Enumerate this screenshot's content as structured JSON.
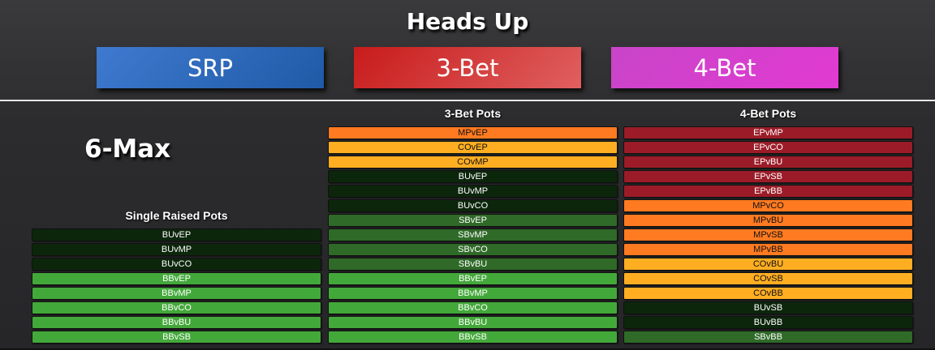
{
  "header": {
    "title": "Heads Up"
  },
  "buttons": [
    {
      "label": "SRP",
      "color": "#2a64b4"
    },
    {
      "label": "3-Bet",
      "color": "#d33a3a"
    },
    {
      "label": "4-Bet",
      "color": "#d63ed0"
    }
  ],
  "format_label": "6-Max",
  "columns": [
    {
      "title": "Single Raised Pots",
      "items": [
        {
          "label": "BUvEP",
          "color": "dark"
        },
        {
          "label": "BUvMP",
          "color": "dark"
        },
        {
          "label": "BUvCO",
          "color": "dark"
        },
        {
          "label": "BBvEP",
          "color": "light"
        },
        {
          "label": "BBvMP",
          "color": "light"
        },
        {
          "label": "BBvCO",
          "color": "light"
        },
        {
          "label": "BBvBU",
          "color": "light"
        },
        {
          "label": "BBvSB",
          "color": "light"
        }
      ]
    },
    {
      "title": "3-Bet Pots",
      "items": [
        {
          "label": "MPvEP",
          "color": "orange"
        },
        {
          "label": "COvEP",
          "color": "yellow"
        },
        {
          "label": "COvMP",
          "color": "yellow"
        },
        {
          "label": "BUvEP",
          "color": "dark"
        },
        {
          "label": "BUvMP",
          "color": "dark"
        },
        {
          "label": "BUvCO",
          "color": "dark"
        },
        {
          "label": "SBvEP",
          "color": "med"
        },
        {
          "label": "SBvMP",
          "color": "med"
        },
        {
          "label": "SBvCO",
          "color": "med"
        },
        {
          "label": "SBvBU",
          "color": "med"
        },
        {
          "label": "BBvEP",
          "color": "light"
        },
        {
          "label": "BBvMP",
          "color": "light"
        },
        {
          "label": "BBvCO",
          "color": "light"
        },
        {
          "label": "BBvBU",
          "color": "light"
        },
        {
          "label": "BBvSB",
          "color": "light"
        }
      ]
    },
    {
      "title": "4-Bet Pots",
      "items": [
        {
          "label": "EPvMP",
          "color": "red"
        },
        {
          "label": "EPvCO",
          "color": "red"
        },
        {
          "label": "EPvBU",
          "color": "red"
        },
        {
          "label": "EPvSB",
          "color": "red"
        },
        {
          "label": "EPvBB",
          "color": "red"
        },
        {
          "label": "MPvCO",
          "color": "orange"
        },
        {
          "label": "MPvBU",
          "color": "orange"
        },
        {
          "label": "MPvSB",
          "color": "orange"
        },
        {
          "label": "MPvBB",
          "color": "orange"
        },
        {
          "label": "COvBU",
          "color": "yellow"
        },
        {
          "label": "COvSB",
          "color": "yellow"
        },
        {
          "label": "COvBB",
          "color": "yellow"
        },
        {
          "label": "BUvSB",
          "color": "dark"
        },
        {
          "label": "BUvBB",
          "color": "dark"
        },
        {
          "label": "SBvBB",
          "color": "med"
        }
      ]
    }
  ]
}
